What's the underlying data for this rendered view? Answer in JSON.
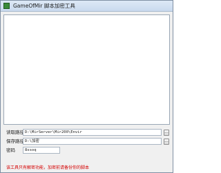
{
  "window": {
    "title": "GameOfMir 脚本加密工具"
  },
  "form": {
    "read_path": {
      "label": "读取路径:",
      "value": "D:\\MirServer\\Mir200\\Envir",
      "browse_label": "..."
    },
    "save_path": {
      "label": "保存路径:",
      "value": "D:\\加密",
      "browse_label": "..."
    },
    "password": {
      "label": "密码",
      "value": "8ssoq"
    }
  },
  "note": "该工具只有解密功能，加密前请备份你的脚本",
  "colors": {
    "note": "#d40000",
    "titlebar": "#dde9f6"
  }
}
